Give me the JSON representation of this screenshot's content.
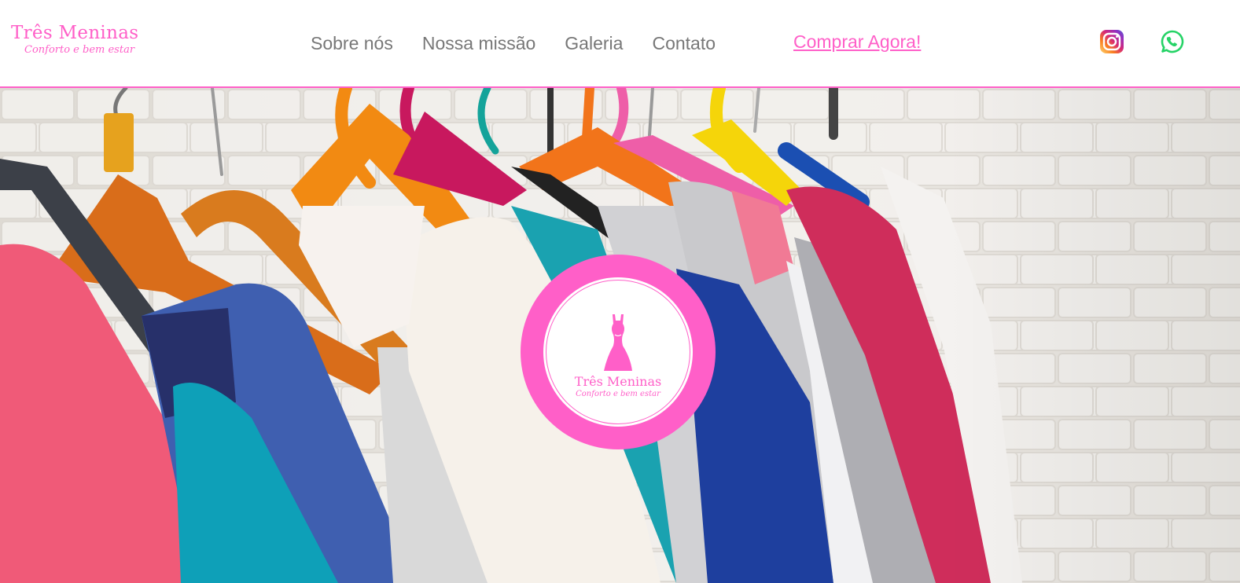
{
  "brand": {
    "name": "Três Meninas",
    "tagline": "Conforto e bem estar"
  },
  "nav": {
    "items": [
      {
        "label": "Sobre nós"
      },
      {
        "label": "Nossa missão"
      },
      {
        "label": "Galeria"
      },
      {
        "label": "Contato"
      }
    ],
    "cta_label": "Comprar Agora!"
  },
  "social": {
    "icons": [
      "instagram-icon",
      "whatsapp-icon"
    ]
  },
  "hero": {
    "image": "clothing-rack-photo",
    "badge": {
      "icon": "dress-icon",
      "title": "Três Meninas",
      "tagline": "Conforto e bem estar"
    }
  },
  "colors": {
    "brand_pink": "#ff5fc8",
    "nav_text": "#777777",
    "whatsapp_green": "#25d366"
  }
}
